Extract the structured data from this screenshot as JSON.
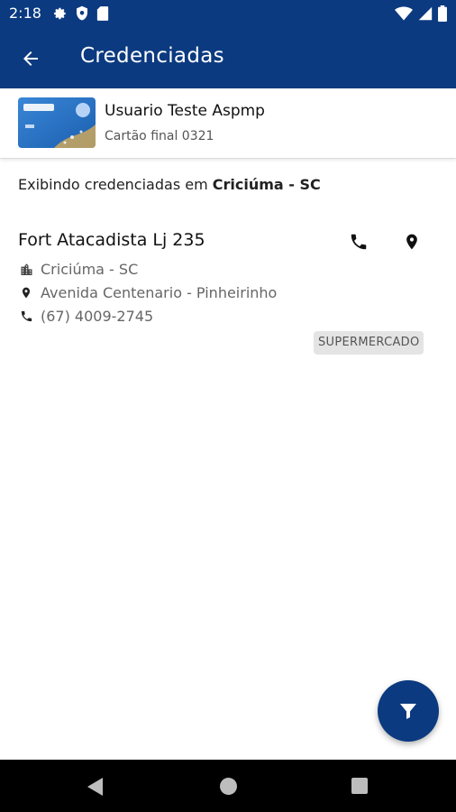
{
  "status_bar": {
    "time": "2:18",
    "left_icons": [
      "settings-icon",
      "shield-icon",
      "sim-card-icon"
    ],
    "right_icons": [
      "wifi-icon",
      "signal-icon",
      "battery-icon"
    ]
  },
  "app_bar": {
    "title": "Credenciadas",
    "back_icon": "arrow-back-icon",
    "background_color": "#0b3a80"
  },
  "user_card": {
    "name": "Usuario Teste Aspmp",
    "card_label": "Cartão final 0321"
  },
  "location": {
    "prefix": "Exibindo credenciadas em",
    "city": "Criciúma - SC"
  },
  "merchants": [
    {
      "name": "Fort Atacadista Lj 235",
      "city": "Criciúma - SC",
      "address": "Avenida Centenario - Pinheirinho",
      "phone": "(67) 4009-2745",
      "category": "SUPERMERCADO"
    }
  ],
  "fab": {
    "icon": "filter-icon"
  },
  "nav_bar": {
    "icons": [
      "nav-back-icon",
      "nav-home-icon",
      "nav-recents-icon"
    ]
  }
}
